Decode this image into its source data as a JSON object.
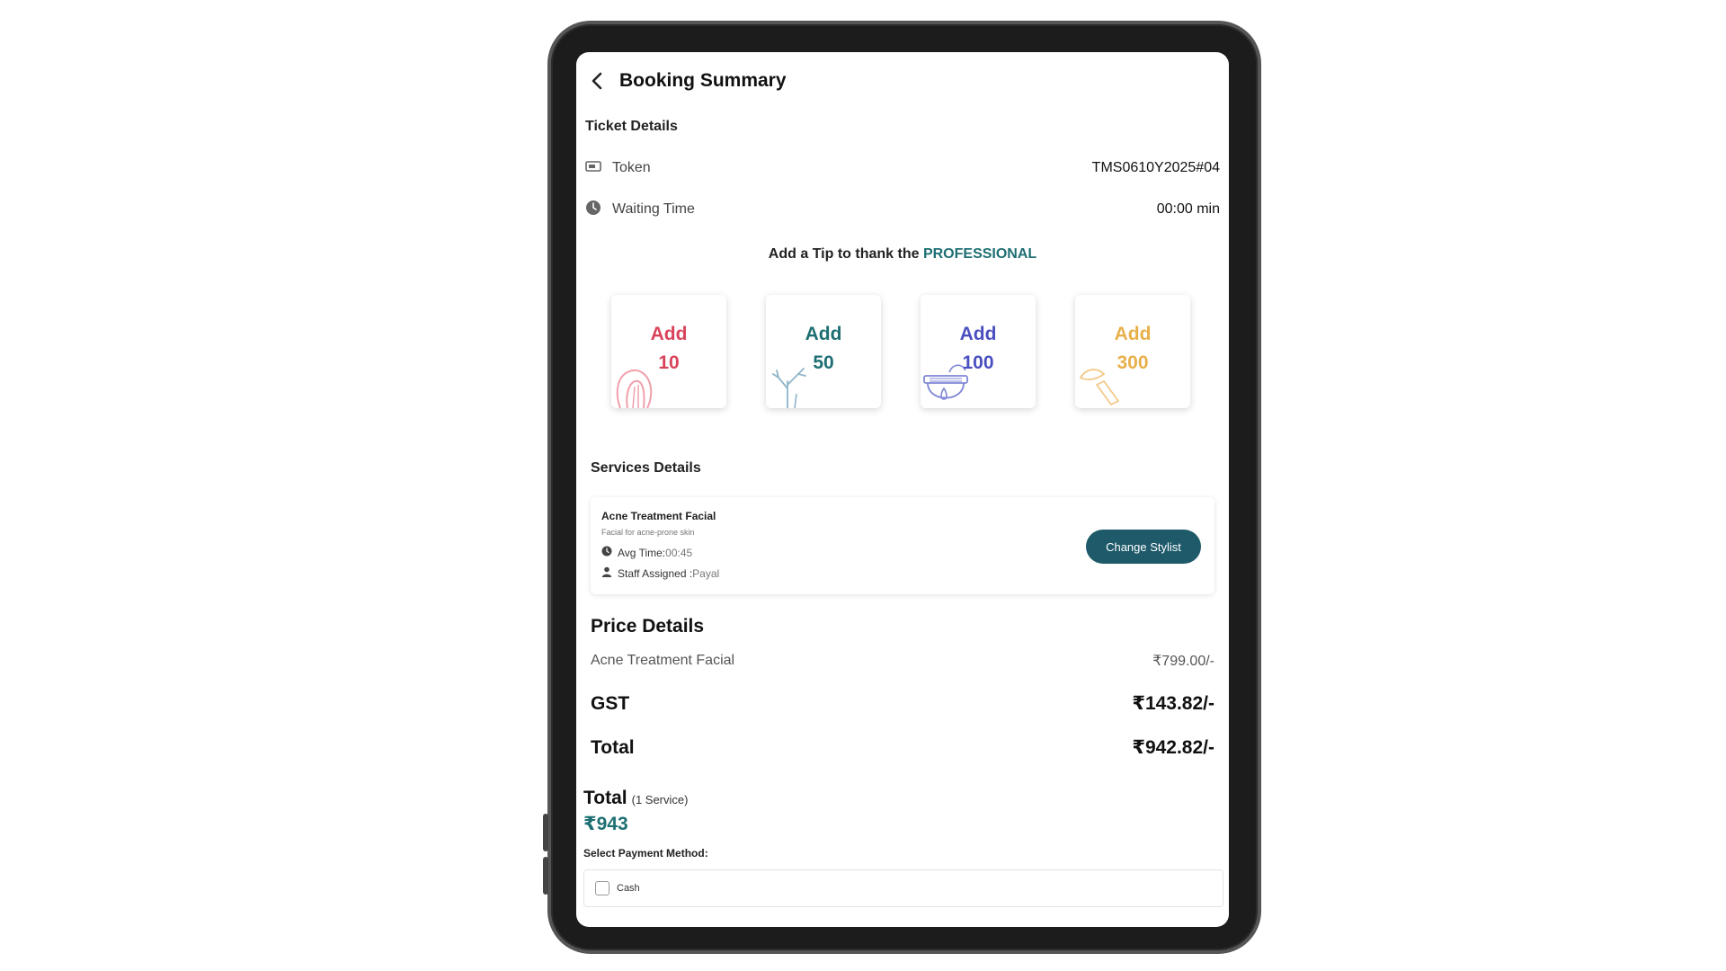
{
  "header": {
    "title": "Booking Summary"
  },
  "ticket": {
    "section_title": "Ticket Details",
    "token_label": "Token",
    "token_value": "TMS0610Y2025#04",
    "waiting_label": "Waiting Time",
    "waiting_value": "00:00 min"
  },
  "tip": {
    "heading_prefix": "Add a Tip to thank the",
    "heading_accent": "PROFESSIONAL",
    "options": [
      {
        "line1": "Add",
        "line2": "10",
        "color": "#d9435a"
      },
      {
        "line1": "Add",
        "line2": "50",
        "color": "#1e6f73"
      },
      {
        "line1": "Add",
        "line2": "100",
        "color": "#4a4fbf"
      },
      {
        "line1": "Add",
        "line2": "300",
        "color": "#e8b04a"
      }
    ]
  },
  "services": {
    "section_title": "Services Details",
    "name": "Acne Treatment Facial",
    "description": "Facial for acne-prone skin",
    "avg_time_label": "Avg Time:",
    "avg_time_value": "00:45",
    "staff_label": "Staff Assigned :",
    "staff_value": "Payal",
    "change_button": "Change Stylist"
  },
  "price": {
    "title": "Price Details",
    "item_label": "Acne Treatment Facial",
    "item_value": "₹799.00/-",
    "gst_label": "GST",
    "gst_value": "₹143.82/-",
    "total_label": "Total",
    "total_value": "₹942.82/-"
  },
  "summary": {
    "total_label": "Total",
    "service_count": "(1 Service)",
    "amount": "₹943",
    "payment_label": "Select Payment Method:",
    "payment_option": "Cash"
  },
  "colors": {
    "accent": "#1e6f73",
    "button": "#1e5a6a"
  }
}
